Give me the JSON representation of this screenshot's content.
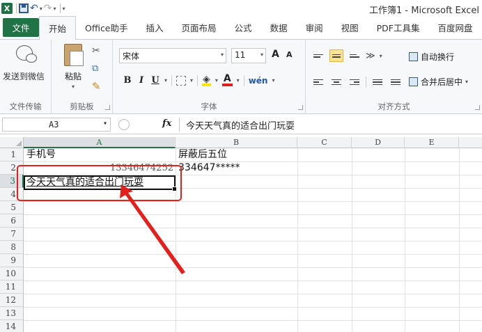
{
  "titlebar": {
    "app_logo": "X",
    "title": "工作簿1 - Microsoft Excel",
    "icons": [
      "excel-logo-icon",
      "save-icon",
      "undo-icon",
      "redo-icon"
    ]
  },
  "tabs": [
    {
      "label": "文件"
    },
    {
      "label": "开始"
    },
    {
      "label": "Office助手"
    },
    {
      "label": "插入"
    },
    {
      "label": "页面布局"
    },
    {
      "label": "公式"
    },
    {
      "label": "数据"
    },
    {
      "label": "审阅"
    },
    {
      "label": "视图"
    },
    {
      "label": "PDF工具集"
    },
    {
      "label": "百度网盘"
    }
  ],
  "ribbon": {
    "wechat": {
      "button": "发送到微信",
      "group": "文件传输"
    },
    "clipboard": {
      "paste": "粘贴",
      "group": "剪贴板"
    },
    "font": {
      "name": "宋体",
      "size": "11",
      "bold": "B",
      "italic": "I",
      "underline": "U",
      "grow": "A",
      "shrink": "A",
      "font_color": "A",
      "wen": "wén",
      "group": "字体"
    },
    "alignment": {
      "wrap": "自动换行",
      "merge": "合并后居中",
      "group": "对齐方式"
    }
  },
  "formula_bar": {
    "name_box": "A3",
    "fx": "fx",
    "content": "今天天气真的适合出门玩耍"
  },
  "grid": {
    "columns": [
      "A",
      "B",
      "C",
      "D",
      "E"
    ],
    "rows": [
      "1",
      "2",
      "3",
      "4",
      "5",
      "6",
      "7",
      "8",
      "9",
      "10",
      "11",
      "12",
      "13",
      "14"
    ],
    "active_cell": "A3",
    "cells": {
      "A1": "手机号",
      "B1": "屏蔽后五位",
      "A2": "13346474252",
      "B2": "334647*****",
      "A3": "今天天气真的适合出门玩耍"
    }
  },
  "annotation": {
    "highlight_color": "#e3201b"
  }
}
